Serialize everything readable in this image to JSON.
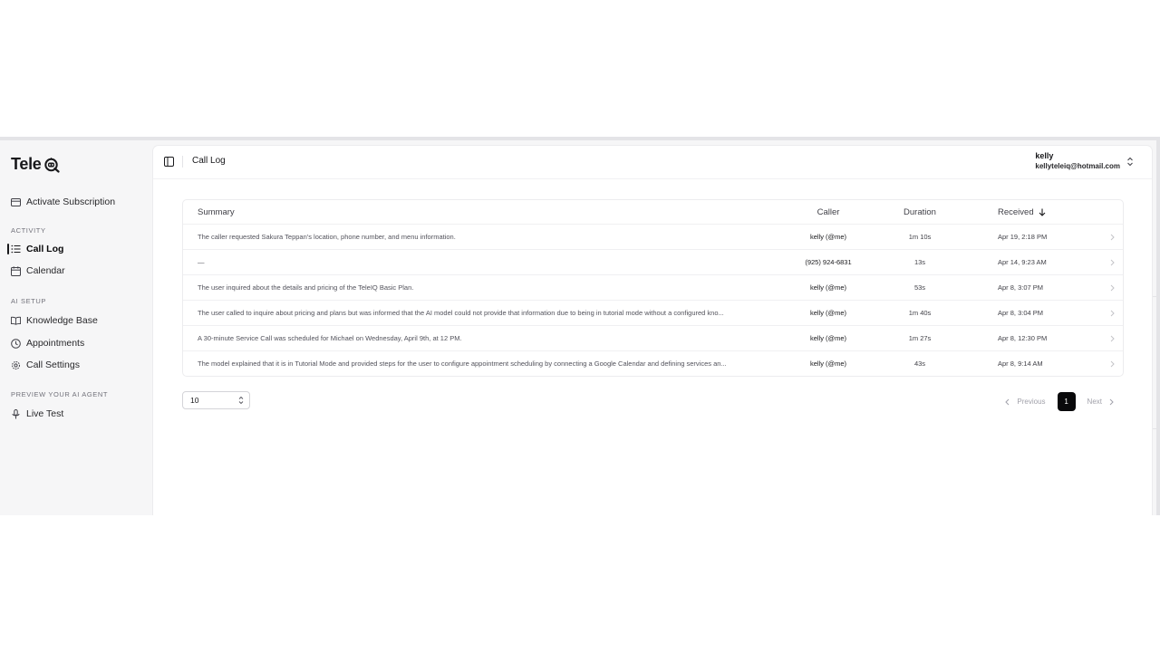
{
  "app": {
    "logo_text": "Tele",
    "logo_mark_text": "iQ"
  },
  "sidebar": {
    "activate_subscription": "Activate Subscription",
    "sections": [
      {
        "label": "ACTIVITY"
      },
      {
        "label": "AI SETUP"
      },
      {
        "label": "PREVIEW YOUR AI AGENT"
      }
    ],
    "items": [
      {
        "label": "Call Log",
        "icon": "list-icon",
        "active": true
      },
      {
        "label": "Calendar",
        "icon": "calendar-icon"
      },
      {
        "label": "Knowledge Base",
        "icon": "book-icon"
      },
      {
        "label": "Appointments",
        "icon": "clock-icon"
      },
      {
        "label": "Call Settings",
        "icon": "gear-icon"
      },
      {
        "label": "Live Test",
        "icon": "microphone-icon"
      }
    ]
  },
  "header": {
    "title": "Call Log",
    "user_name": "kelly",
    "user_email": "kellyteleiq@hotmail.com"
  },
  "table": {
    "columns": {
      "summary": "Summary",
      "caller": "Caller",
      "duration": "Duration",
      "received": "Received"
    },
    "rows": [
      {
        "summary": "The caller requested Sakura Teppan's location, phone number, and menu information.",
        "caller": "kelly (@me)",
        "duration": "1m 10s",
        "received": "Apr 19, 2:18 PM"
      },
      {
        "summary": "—",
        "caller": "(925) 924-6831",
        "duration": "13s",
        "received": "Apr 14, 9:23 AM"
      },
      {
        "summary": "The user inquired about the details and pricing of the TeleIQ Basic Plan.",
        "caller": "kelly (@me)",
        "duration": "53s",
        "received": "Apr 8, 3:07 PM"
      },
      {
        "summary": "The user called to inquire about pricing and plans but was informed that the AI model could not provide that information due to being in tutorial mode without a configured kno...",
        "caller": "kelly (@me)",
        "duration": "1m 40s",
        "received": "Apr 8, 3:04 PM"
      },
      {
        "summary": "A 30-minute Service Call was scheduled for Michael on Wednesday, April 9th, at 12 PM.",
        "caller": "kelly (@me)",
        "duration": "1m 27s",
        "received": "Apr 8, 12:30 PM"
      },
      {
        "summary": "The model explained that it is in Tutorial Mode and provided steps for the user to configure appointment scheduling by connecting a Google Calendar and defining services an...",
        "caller": "kelly (@me)",
        "duration": "43s",
        "received": "Apr 8, 9:14 AM"
      }
    ]
  },
  "pagination": {
    "page_size": "10",
    "previous": "Previous",
    "current_page": "1",
    "next": "Next"
  }
}
